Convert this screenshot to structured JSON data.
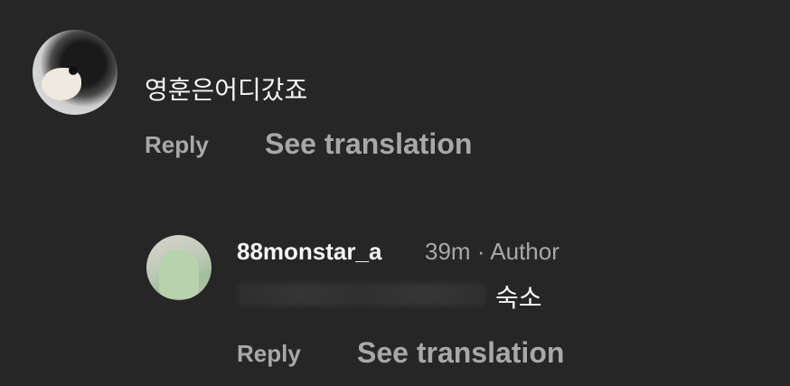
{
  "comment": {
    "text": "영훈은어디갔죠",
    "reply_label": "Reply",
    "translate_label": "See translation"
  },
  "reply": {
    "username": "88monstar_a",
    "time": "39m",
    "separator": "·",
    "role": "Author",
    "text": "숙소",
    "reply_label": "Reply",
    "translate_label": "See translation"
  }
}
